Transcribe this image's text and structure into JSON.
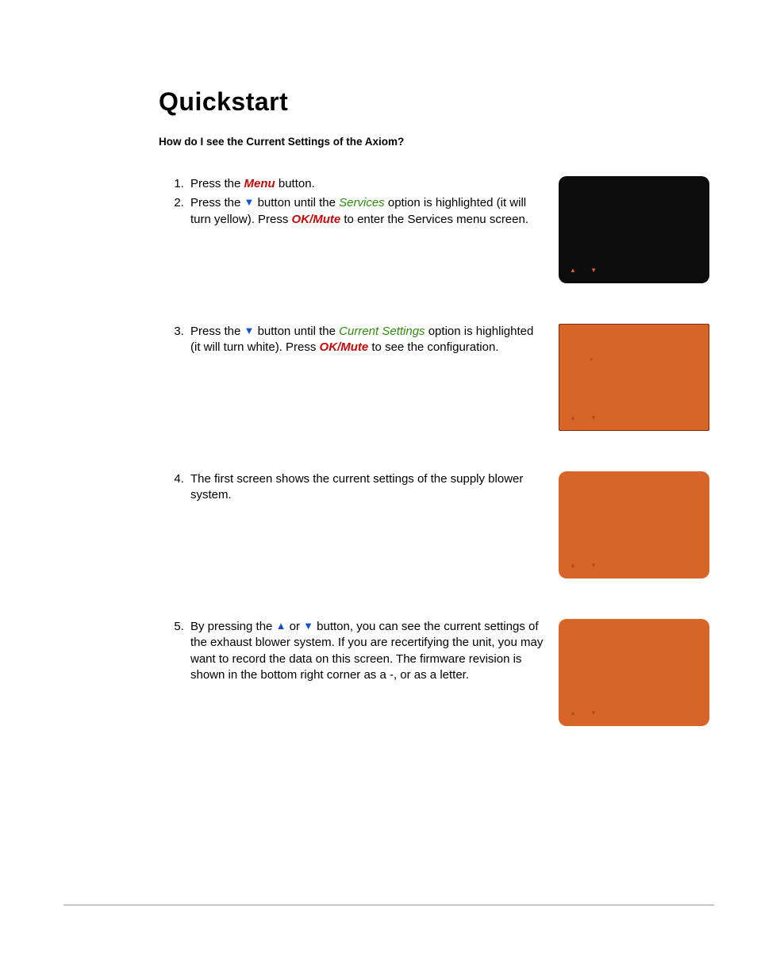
{
  "title": "Quickstart",
  "subheading": "How do I see the Current Settings of the Axiom?",
  "labels": {
    "menu": "Menu",
    "services": "Services",
    "current_settings": "Current Settings",
    "okmute": "OK/Mute"
  },
  "symbols": {
    "up": "▲",
    "down": "▼"
  },
  "steps": {
    "s1_pre": "Press the ",
    "s1_post": " button.",
    "s2_a": "Press the ",
    "s2_b": " button until the ",
    "s2_c": " option is highlighted (it will turn yellow). Press ",
    "s2_d": " to enter the Services menu screen.",
    "s3_a": "Press the ",
    "s3_b": " button until the ",
    "s3_c": " option is highlighted (it will turn white). Press ",
    "s3_d": " to see the configuration.",
    "s4": "The first screen shows the current settings of the supply blower system.",
    "s5_a": "By pressing the ",
    "s5_mid": " or ",
    "s5_b": " button, you can see the current settings of the exhaust blower system. If you are recertifying the unit, you may want to record the data on this screen. The firmware revision is shown in the bottom right corner as a -, or as a letter."
  },
  "screens": {
    "nav": "▲  ▼",
    "mini_arrow": "▸"
  }
}
